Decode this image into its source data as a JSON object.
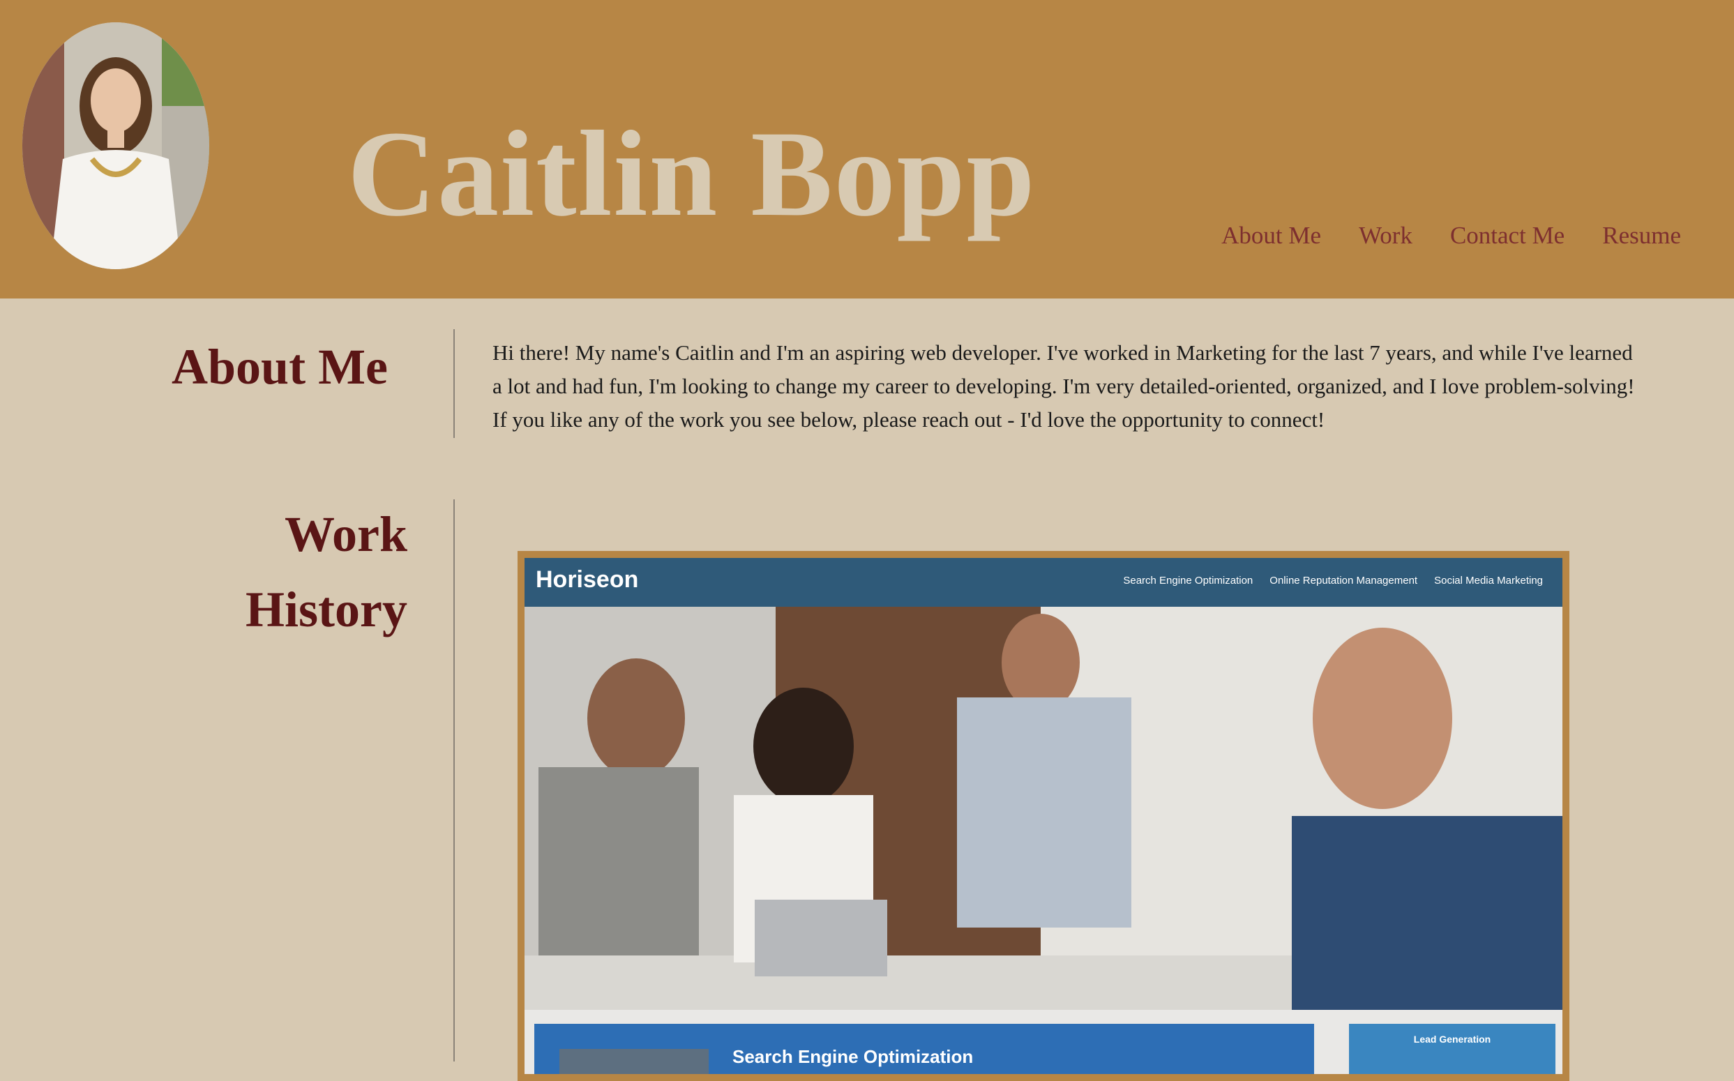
{
  "header": {
    "site_title": "Caitlin Bopp",
    "nav": [
      {
        "label": "About Me"
      },
      {
        "label": "Work"
      },
      {
        "label": "Contact Me"
      },
      {
        "label": "Resume"
      }
    ]
  },
  "about": {
    "heading": "About Me",
    "body": "Hi there! My name's Caitlin and I'm an aspiring web developer. I've worked in Marketing for the last 7 years, and while I've learned a lot and had fun, I'm looking to change my career to developing. I'm very detailed-oriented, organized, and I love problem-solving! If you like any of the work you see below, please reach out - I'd love the opportunity to connect!"
  },
  "work": {
    "heading_line1": "Work",
    "heading_line2": "History",
    "project": {
      "brand": "Horiseon",
      "nav": [
        "Search Engine Optimization",
        "Online Reputation Management",
        "Social Media Marketing"
      ],
      "section_label": "Search Engine Optimization",
      "sidebar_label": "Lead Generation"
    }
  },
  "colors": {
    "header_bg": "#b78645",
    "page_bg": "#d7c9b2",
    "title_color": "#d8cab2",
    "nav_color": "#7d2f2f",
    "heading_color": "#5a1515"
  }
}
